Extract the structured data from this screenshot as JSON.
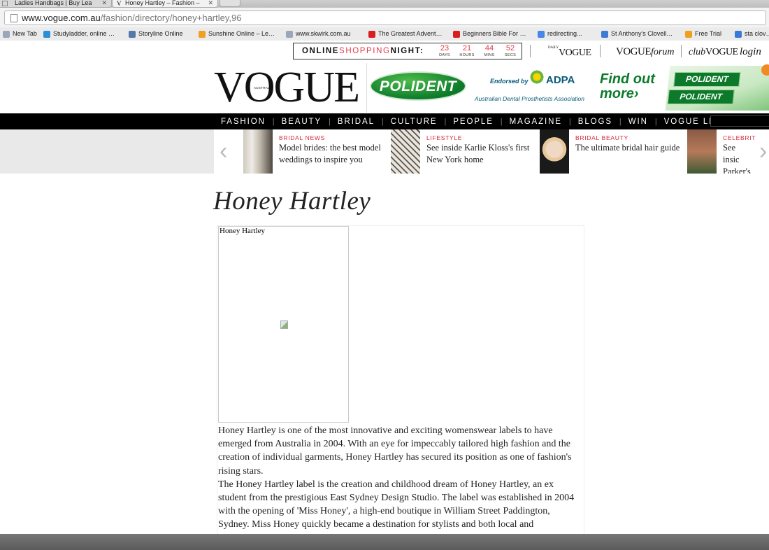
{
  "browser": {
    "tabs": [
      {
        "label": "Ladies Handbags | Buy Lea"
      },
      {
        "label": "Honey Hartley – Fashion –"
      }
    ],
    "tab_close": "✕",
    "url_main": "www.vogue.com.au",
    "url_path": "/fashion/directory/honey+hartley,96",
    "bookmarks": [
      {
        "label": "New Tab",
        "icon": "page-icon",
        "color": "#9aa7b8"
      },
      {
        "label": "Studyladder, online …",
        "icon": "s-logo-icon",
        "color": "#2a8fd4"
      },
      {
        "label": "Storyline Online",
        "icon": "book-icon",
        "color": "#5577aa"
      },
      {
        "label": "Sunshine Online – Le…",
        "icon": "s-logo-icon",
        "color": "#f0a020"
      },
      {
        "label": "www.skwirk.com.au",
        "icon": "page-icon",
        "color": "#9aa7b8"
      },
      {
        "label": "The Greatest Advent…",
        "icon": "youtube-icon",
        "color": "#d81f1f"
      },
      {
        "label": "Beginners Bible For …",
        "icon": "youtube-icon",
        "color": "#d81f1f"
      },
      {
        "label": "redirecting...",
        "icon": "google-icon",
        "color": "#4a86e8"
      },
      {
        "label": "St Anthony's Clovell…",
        "icon": "site-icon",
        "color": "#3a7bd5"
      },
      {
        "label": "Free Trial",
        "icon": "s-logo-icon",
        "color": "#f0a020"
      },
      {
        "label": "sta clov…",
        "icon": "site-icon",
        "color": "#3a7bd5"
      }
    ]
  },
  "promo": {
    "title_bold_1": "ONLINE",
    "title_red": "SHOPPING",
    "title_bold_2": "NIGHT:",
    "countdown": [
      {
        "n": "23",
        "u": "DAYS"
      },
      {
        "n": "21",
        "u": "HOURS"
      },
      {
        "n": "44",
        "u": "MINS"
      },
      {
        "n": "52",
        "u": "SECS"
      }
    ],
    "links": {
      "daily_small": "DAILY",
      "daily": "VOGUE",
      "forum_vogue": "VOGUE",
      "forum": "forum",
      "club_prefix": "club",
      "club": "VOGUE",
      "login": "login"
    }
  },
  "header": {
    "logo": "VOGUE",
    "logo_sub": "AUSTRALIA"
  },
  "ad": {
    "brand": "POLIDENT",
    "endorsed": "Endorsed by",
    "adpa": "ADPA",
    "assoc": "Australian Dental Prosthetists Association",
    "cta_1": "Find out",
    "cta_2": "more›",
    "box_label": "POLIDENT",
    "colors": {
      "green": "#0c7a2a",
      "blue": "#0a5a7a"
    }
  },
  "nav": {
    "items": [
      "FASHION",
      "BEAUTY",
      "BRIDAL",
      "CULTURE",
      "PEOPLE",
      "MAGAZINE",
      "BLOGS",
      "WIN",
      "VOGUE LIVING"
    ],
    "divider": "|"
  },
  "carousel": {
    "prev": "‹",
    "next": "›",
    "cards": [
      {
        "category": "BRIDAL NEWS",
        "title": "Model brides: the best model weddings to inspire you"
      },
      {
        "category": "LIFESTYLE",
        "title": "See inside Karlie Kloss's first New York home"
      },
      {
        "category": "BRIDAL BEAUTY",
        "title": "The ultimate bridal hair guide"
      },
      {
        "category": "CELEBRIT",
        "title": "See insic Parker's"
      }
    ]
  },
  "main": {
    "title": "Honey Hartley",
    "image_alt": "Honey Hartley",
    "paragraphs": [
      "Honey Hartley is one of the most innovative and exciting womenswear labels to have emerged from Australia in 2004. With an eye for impeccably tailored high fashion and the creation of individual garments, Honey Hartley has secured its position as one of fashion's rising stars.",
      "The Honey Hartley label is the creation and childhood dream of Honey Hartley, an ex student from the prestigious East Sydney Design Studio. The label was established in 2004 with the opening of 'Miss Honey', a high-end boutique in William Street Paddington, Sydney. Miss Honey quickly became a destination for stylists and both local and"
    ]
  }
}
